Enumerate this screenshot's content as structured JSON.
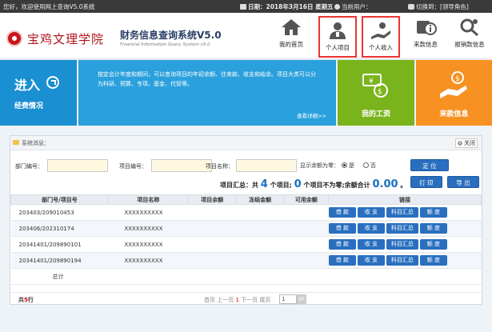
{
  "topbar": {
    "welcome": "您好，欢迎使用网上查询V5.0系统",
    "date": "日期：2018年3月16日 星期五",
    "current_user_label": "当前用户：",
    "current_user": "",
    "switch_label": "切换到：",
    "switch_role": "[领导角色]"
  },
  "header": {
    "school": "宝鸡文理学院",
    "title": "财务信息查询系统V5.0",
    "subtitle": "Financial Information Query System v5.0",
    "nav": [
      {
        "label": "我的首页",
        "icon": "home-icon"
      },
      {
        "label": "个人项目",
        "icon": "person-icon"
      },
      {
        "label": "个人收入",
        "icon": "income-icon"
      },
      {
        "label": "来款信息",
        "icon": "info-icon"
      },
      {
        "label": "报销款信息",
        "icon": "search-money-icon"
      }
    ]
  },
  "banner": {
    "enter": "进入",
    "enter_sub": "经费情况",
    "description": "按定会计年度和期间，可以查询项目的年初余额、往来款、收支和结余。项目大类可以分为科研、预算、专项、基金、代管等。",
    "more": "查看详细>>",
    "salary": "我的工资",
    "incoming": "来款信息"
  },
  "panel": {
    "sysmsg_label": "系统消息：",
    "close_label": "关闭",
    "filters": {
      "dept_label": "部门编号：",
      "project_no_label": "项目编号：",
      "project_name_label": "项目名称：",
      "show_zero_label": "显示余额为零：",
      "yes_label": "是",
      "no_label": "否"
    },
    "buttons": {
      "locate": "定 位",
      "print": "打 印",
      "export": "导 出"
    },
    "summary": {
      "prefix": "项目汇总：共",
      "count": "4",
      "mid1": "个项目;",
      "nonzero": "0",
      "mid2": "个项目不为零;余额合计",
      "total": "0.00",
      "suffix": "。"
    },
    "table": {
      "headers": [
        "部门号/项目号",
        "项目名称",
        "项目余额",
        "冻结金额",
        "可用余额",
        "链接"
      ],
      "rows": [
        {
          "id": "203403/209010453",
          "name": "XXXXXXXXXX"
        },
        {
          "id": "203406/202310174",
          "name": "XXXXXXXXXX"
        },
        {
          "id": "20341401/209890101",
          "name": "XXXXXXXXXX"
        },
        {
          "id": "20341401/209890194",
          "name": "XXXXXXXXXX"
        }
      ],
      "links": [
        "借 款",
        "收 支",
        "科目汇总",
        "额 度"
      ],
      "total_label": "总计"
    },
    "footer": {
      "rows_prefix": "共",
      "rows_count": "5",
      "rows_suffix": "行",
      "first": "首页",
      "prev": "上一页",
      "current": "1",
      "next": "下一页",
      "last": "尾页",
      "page_input": "1",
      "go": "go"
    }
  },
  "colors": {
    "topbar": "#3a3a3a",
    "brand_red": "#b0131a",
    "blue_tile": "#1a8fd1",
    "desc_blue": "#2aa0dc",
    "green_tile": "#7ab41c",
    "orange_tile": "#f79121",
    "button_blue": "#2a6fbf"
  }
}
